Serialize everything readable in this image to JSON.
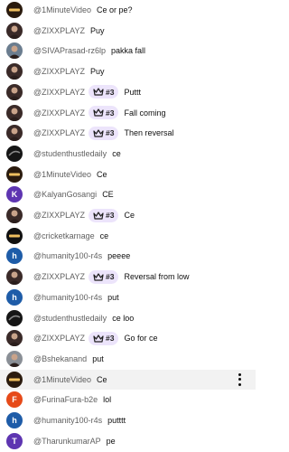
{
  "messages": [
    {
      "author": "@1MinuteVideo",
      "badge": "",
      "text": "Ce or pe?",
      "avatar": {
        "kind": "logo",
        "color": "#2b1b0e"
      }
    },
    {
      "author": "@ZIXXPLAYZ",
      "badge": "",
      "text": "Puy",
      "avatar": {
        "kind": "photo",
        "color": "#3a2a28"
      }
    },
    {
      "author": "@SIVAPrasad-rz6lp",
      "badge": "",
      "text": "pakka fall",
      "avatar": {
        "kind": "photo",
        "color": "#6b7d8f"
      }
    },
    {
      "author": "@ZIXXPLAYZ",
      "badge": "",
      "text": "Puy",
      "avatar": {
        "kind": "photo",
        "color": "#3a2a28"
      }
    },
    {
      "author": "@ZIXXPLAYZ",
      "badge": "#3",
      "text": "Puttt",
      "avatar": {
        "kind": "photo",
        "color": "#3a2a28"
      }
    },
    {
      "author": "@ZIXXPLAYZ",
      "badge": "#3",
      "text": "Fall coming",
      "avatar": {
        "kind": "photo",
        "color": "#3a2a28"
      }
    },
    {
      "author": "@ZIXXPLAYZ",
      "badge": "#3",
      "text": "Then reversal",
      "avatar": {
        "kind": "photo",
        "color": "#3a2a28"
      }
    },
    {
      "author": "@studenthustledaily",
      "badge": "",
      "text": "ce",
      "avatar": {
        "kind": "dark",
        "color": "#151515"
      }
    },
    {
      "author": "@1MinuteVideo",
      "badge": "",
      "text": "Ce",
      "avatar": {
        "kind": "logo",
        "color": "#2b1b0e"
      }
    },
    {
      "author": "@KalyanGosangi",
      "badge": "",
      "text": "CE",
      "avatar": {
        "kind": "letter",
        "letter": "K",
        "color": "#5e35b1"
      }
    },
    {
      "author": "@ZIXXPLAYZ",
      "badge": "#3",
      "text": "Ce",
      "avatar": {
        "kind": "photo",
        "color": "#3a2a28"
      }
    },
    {
      "author": "@cricketkarnage",
      "badge": "",
      "text": "ce",
      "avatar": {
        "kind": "logo",
        "color": "#111111"
      }
    },
    {
      "author": "@humanity100-r4s",
      "badge": "",
      "text": "peeee",
      "avatar": {
        "kind": "letter",
        "letter": "h",
        "color": "#1e5ca8"
      }
    },
    {
      "author": "@ZIXXPLAYZ",
      "badge": "#3",
      "text": "Reversal from low",
      "avatar": {
        "kind": "photo",
        "color": "#3a2a28"
      }
    },
    {
      "author": "@humanity100-r4s",
      "badge": "",
      "text": "put",
      "avatar": {
        "kind": "letter",
        "letter": "h",
        "color": "#1e5ca8"
      }
    },
    {
      "author": "@studenthustledaily",
      "badge": "",
      "text": "ce loo",
      "avatar": {
        "kind": "dark",
        "color": "#151515"
      }
    },
    {
      "author": "@ZIXXPLAYZ",
      "badge": "#3",
      "text": "Go for ce",
      "avatar": {
        "kind": "photo",
        "color": "#3a2a28"
      }
    },
    {
      "author": "@Bshekanand",
      "badge": "",
      "text": "put",
      "avatar": {
        "kind": "photo",
        "color": "#8a8f96"
      }
    },
    {
      "author": "@1MinuteVideo",
      "badge": "",
      "text": "Ce",
      "avatar": {
        "kind": "logo",
        "color": "#2b1b0e"
      },
      "highlighted": true
    },
    {
      "author": "@FurinaFura-b2e",
      "badge": "",
      "text": "lol",
      "avatar": {
        "kind": "letter",
        "letter": "F",
        "color": "#e64a19"
      }
    },
    {
      "author": "@humanity100-r4s",
      "badge": "",
      "text": "putttt",
      "avatar": {
        "kind": "letter",
        "letter": "h",
        "color": "#1e5ca8"
      }
    },
    {
      "author": "@TharunkumarAP",
      "badge": "",
      "text": "pe",
      "avatar": {
        "kind": "letter",
        "letter": "T",
        "color": "#5e35b1"
      }
    }
  ]
}
